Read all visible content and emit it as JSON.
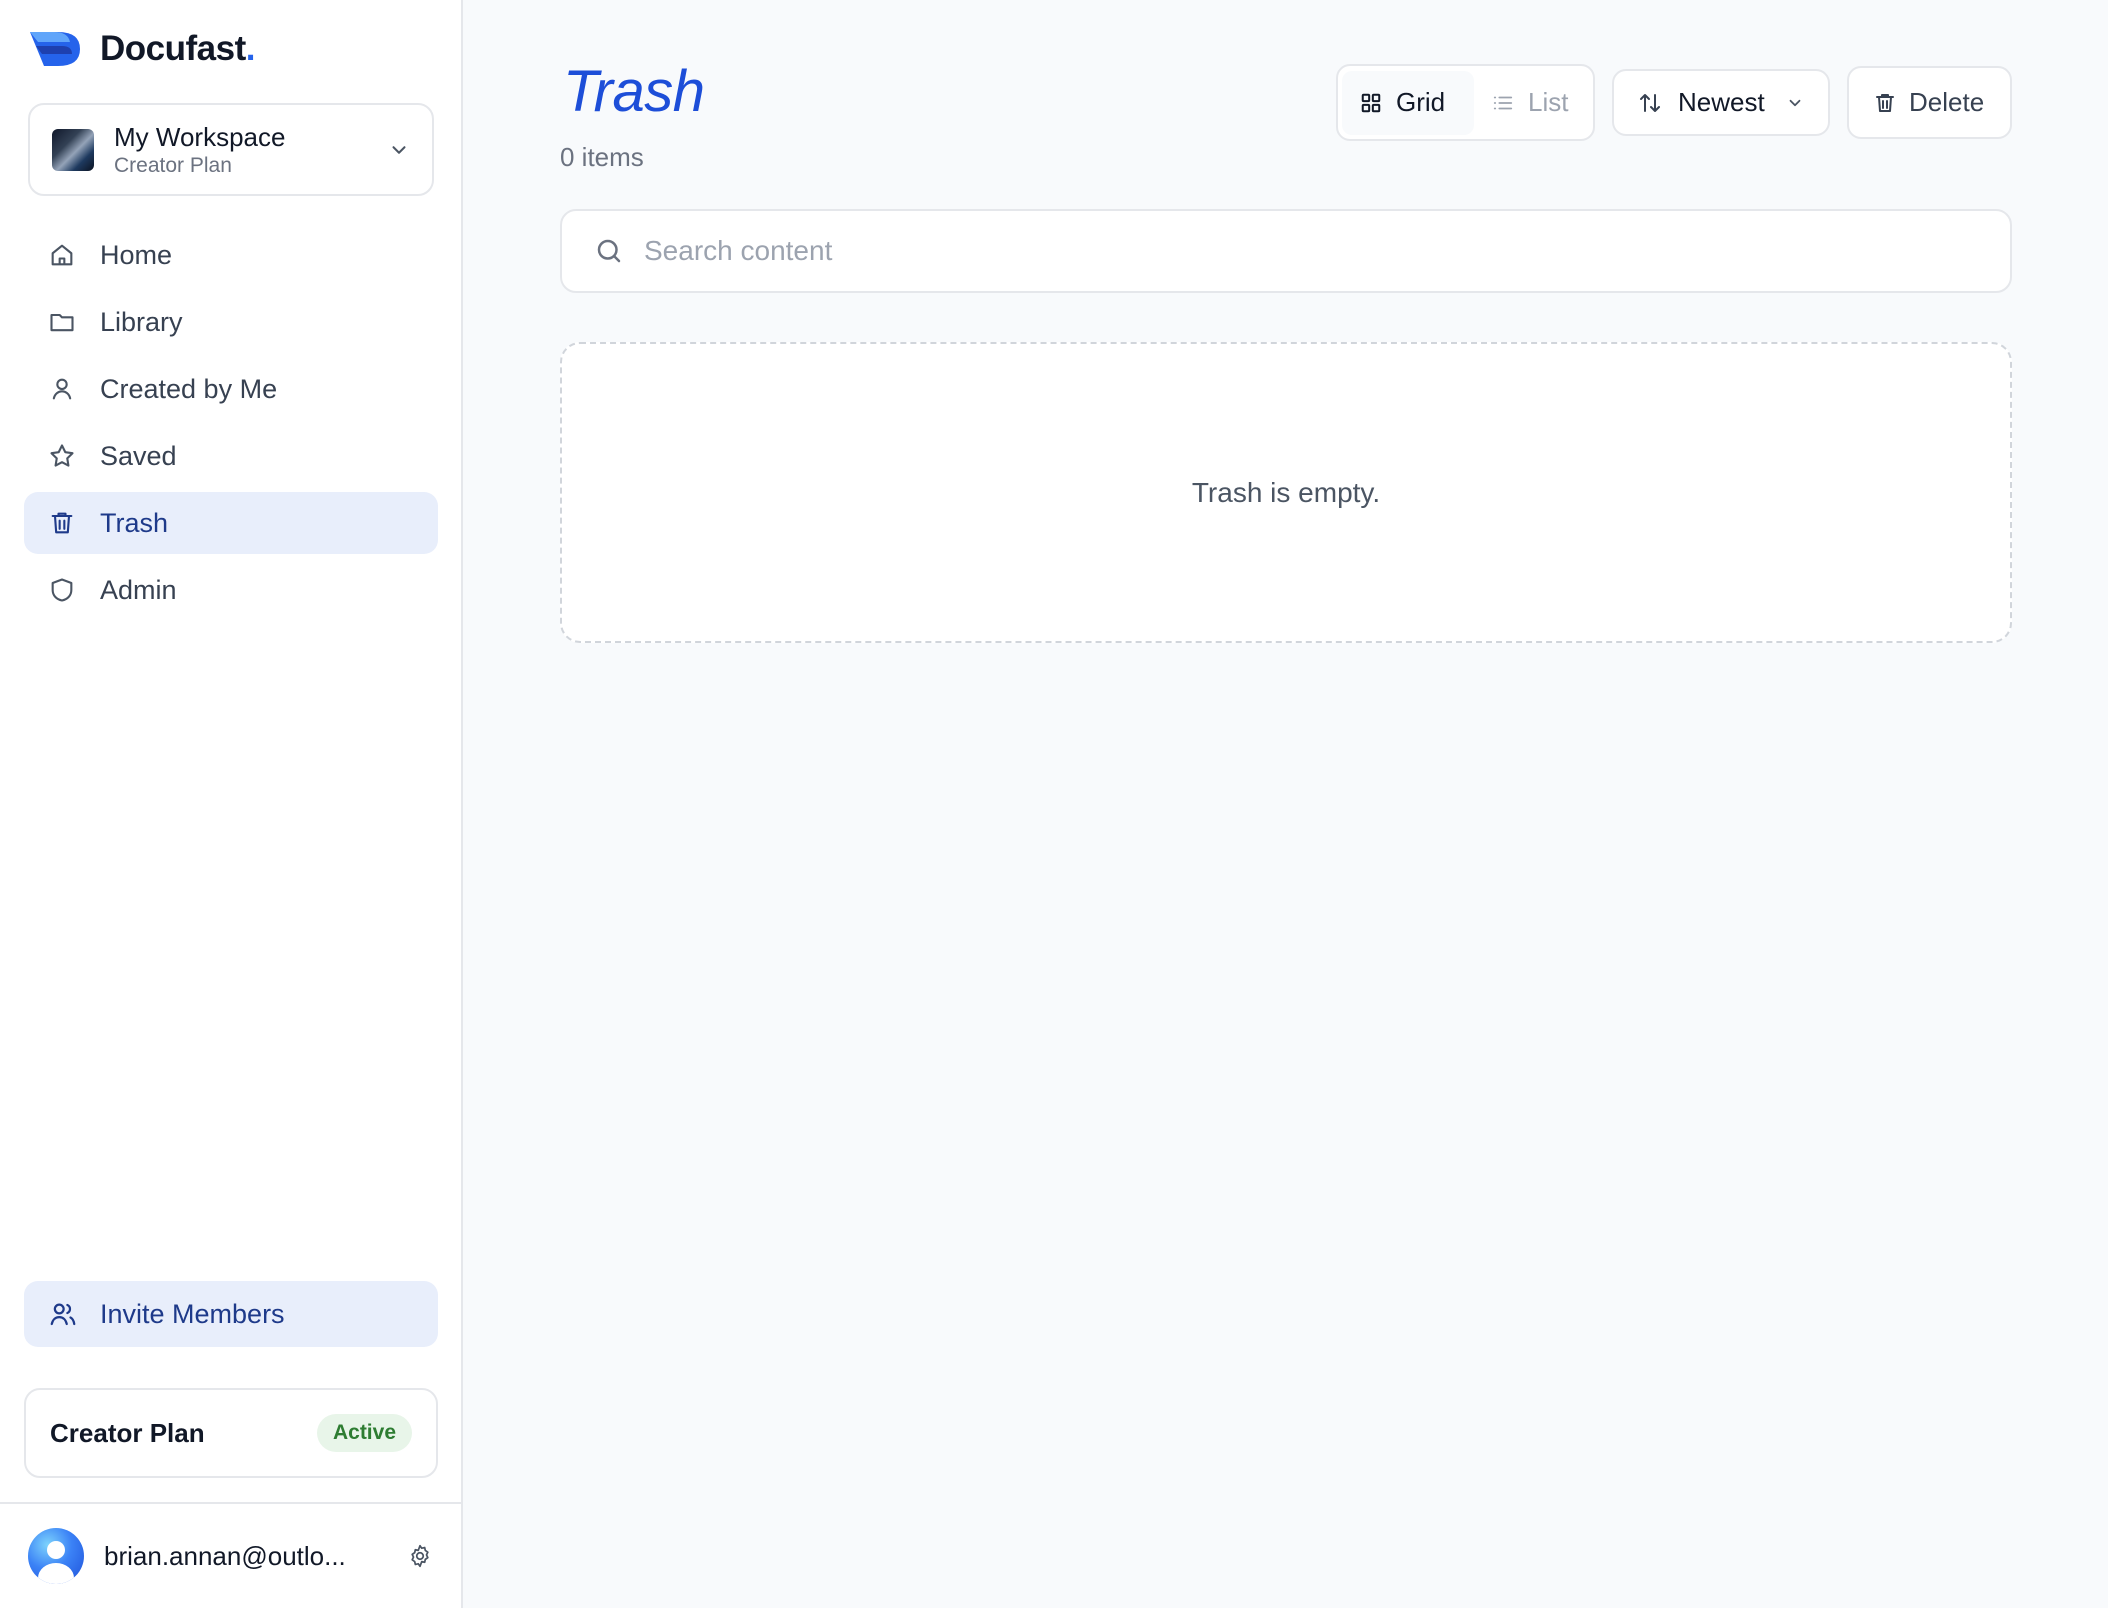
{
  "brand": {
    "name": "Docufast",
    "dot": "."
  },
  "workspace": {
    "name": "My Workspace",
    "plan": "Creator Plan"
  },
  "nav": [
    {
      "label": "Home",
      "icon": "home-icon",
      "active": false
    },
    {
      "label": "Library",
      "icon": "folder-icon",
      "active": false
    },
    {
      "label": "Created by Me",
      "icon": "user-icon",
      "active": false
    },
    {
      "label": "Saved",
      "icon": "star-icon",
      "active": false
    },
    {
      "label": "Trash",
      "icon": "trash-icon",
      "active": true
    },
    {
      "label": "Admin",
      "icon": "shield-icon",
      "active": false
    }
  ],
  "invite": {
    "label": "Invite Members",
    "icon": "users-icon"
  },
  "plan_card": {
    "name": "Creator Plan",
    "status": "Active"
  },
  "user": {
    "email": "brian.annan@outlo..."
  },
  "page": {
    "title": "Trash",
    "count": "0 items"
  },
  "toolbar": {
    "grid_label": "Grid",
    "list_label": "List",
    "sort_label": "Newest",
    "delete_label": "Delete"
  },
  "search": {
    "placeholder": "Search content",
    "value": ""
  },
  "empty": {
    "message": "Trash is empty."
  },
  "colors": {
    "accent": "#1d4ed8",
    "active_bg": "#e8eefb",
    "badge_bg": "#e8f5e9",
    "badge_text": "#2e7d32"
  }
}
